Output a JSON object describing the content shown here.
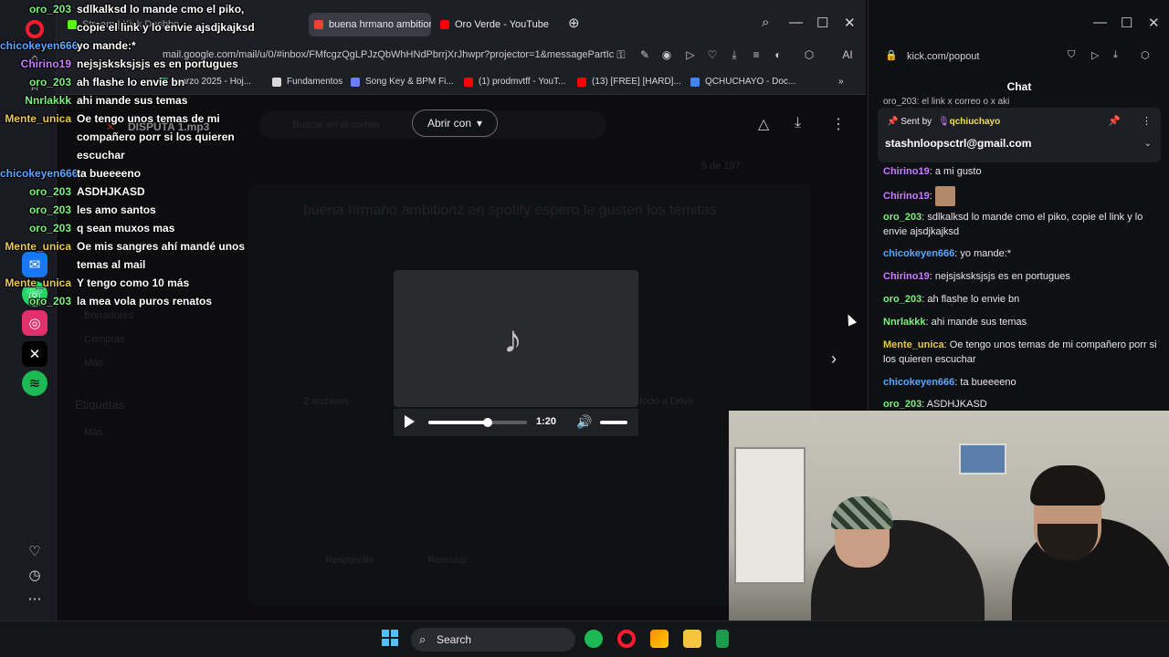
{
  "browser": {
    "tabs": [
      {
        "label": "Stream | Kick Dashbo..."
      },
      {
        "label": "buena hrmano ambitionz"
      },
      {
        "label": "Oro Verde - YouTube"
      }
    ],
    "url": "mail.google.com/mail/u/0/#inbox/FMfcgzQgLPJzQbWhHNdPbrrjXrJhwpr?projector=1&messagePartIc",
    "ai_label": "AI",
    "bookmarks": [
      {
        "label": "marzo 2025 - Hoj...",
        "color": "#1aa260"
      },
      {
        "label": "Fundamentos",
        "color": "#d8d8d8"
      },
      {
        "label": "Song Key & BPM Fi...",
        "color": "#6b7cff"
      },
      {
        "label": "(1) prodmvtff - YouT...",
        "color": "#ff0000"
      },
      {
        "label": "(13) [FREE] [HARD]...",
        "color": "#ff0000"
      },
      {
        "label": "QCHUCHAYO - Doc...",
        "color": "#4285f4"
      }
    ]
  },
  "gmail": {
    "search_placeholder": "Buscar en el correo",
    "subject": "buena hrmano ambitionz en spotify espero le gusten los temitas",
    "file_name": "DISPUTA 1.mp3",
    "open_with": "Abrir con",
    "sidebar_labels": [
      "Borradores",
      "Compras",
      "Más",
      "Etiquetas",
      "Más"
    ],
    "reply": "Responder",
    "forward": "Reenviar",
    "add_all_drive": "Agregar todo a Drive",
    "attachments": "2 archivos",
    "pagination": "5 de 197"
  },
  "player": {
    "time": "1:20",
    "progress": 0.6,
    "volume": 0.85
  },
  "popout": {
    "url": "kick.com/popout",
    "chat_title": "Chat",
    "partial_top": "oro_203: el link x correo o x aki",
    "pinned": {
      "sent_by_label": "Sent by",
      "sent_by_user": "qchiuchayo",
      "message": "stashnloopsctrl@gmail.com"
    },
    "messages": [
      {
        "user": "Chirino19",
        "color": "#c77dff",
        "text": "a mi gusto"
      },
      {
        "user": "Chirino19",
        "color": "#c77dff",
        "text": ""
      },
      {
        "user": "oro_203",
        "color": "#7cf07c",
        "text": "sdlkalksd lo mande cmo el piko, copie el link y lo envie ajsdjkajksd"
      },
      {
        "user": "chicokeyen666",
        "color": "#5aa7ff",
        "text": "yo mande:*"
      },
      {
        "user": "Chirino19",
        "color": "#c77dff",
        "text": "nejsjsksksjsjs es en portugues"
      },
      {
        "user": "oro_203",
        "color": "#7cf07c",
        "text": "ah flashe lo envie bn"
      },
      {
        "user": "Nnrlakkk",
        "color": "#7cf07c",
        "text": "ahi mande sus temas"
      },
      {
        "user": "Mente_unica",
        "color": "#e8c84a",
        "text": "Oe tengo unos temas de mi compañero porr si los quieren escuchar"
      },
      {
        "user": "chicokeyen666",
        "color": "#5aa7ff",
        "text": "ta bueeeeno"
      },
      {
        "user": "oro_203",
        "color": "#7cf07c",
        "text": "ASDHJKASD"
      }
    ]
  },
  "overlay_chat": [
    {
      "user": "oro_203",
      "color": "#7cf07c",
      "text": "sdlkalksd lo mande cmo el piko,"
    },
    {
      "user": "",
      "color": "#7cf07c",
      "text": "copie el link y lo envie ajsdjkajksd"
    },
    {
      "user": "chicokeyen666",
      "color": "#5aa7ff",
      "text": "yo mande:*"
    },
    {
      "user": "Chirino19",
      "color": "#c77dff",
      "text": "nejsjsksksjsjs es en portugues"
    },
    {
      "user": "oro_203",
      "color": "#7cf07c",
      "text": "ah flashe lo envie bn"
    },
    {
      "user": "Nnrlakkk",
      "color": "#7cf07c",
      "text": "ahi mande sus temas"
    },
    {
      "user": "Mente_unica",
      "color": "#e8c84a",
      "text": "Oe tengo unos temas de mi"
    },
    {
      "user": "",
      "color": "#e8c84a",
      "text": "compañero porr si los quieren"
    },
    {
      "user": "",
      "color": "#e8c84a",
      "text": "escuchar"
    },
    {
      "user": "chicokeyen666",
      "color": "#5aa7ff",
      "text": "ta bueeeeno"
    },
    {
      "user": "oro_203",
      "color": "#7cf07c",
      "text": "ASDHJKASD"
    },
    {
      "user": "oro_203",
      "color": "#7cf07c",
      "text": "les amo santos"
    },
    {
      "user": "oro_203",
      "color": "#7cf07c",
      "text": "q sean muxos mas"
    },
    {
      "user": "Mente_unica",
      "color": "#e8c84a",
      "text": "Oe mis sangres ahí mandé unos"
    },
    {
      "user": "",
      "color": "#e8c84a",
      "text": "temas al mail"
    },
    {
      "user": "Mente_unica",
      "color": "#e8c84a",
      "text": "Y tengo como 10 más"
    },
    {
      "user": "oro_203",
      "color": "#7cf07c",
      "text": "la mea vola puros renatos"
    }
  ],
  "taskbar": {
    "search_label": "Search"
  }
}
